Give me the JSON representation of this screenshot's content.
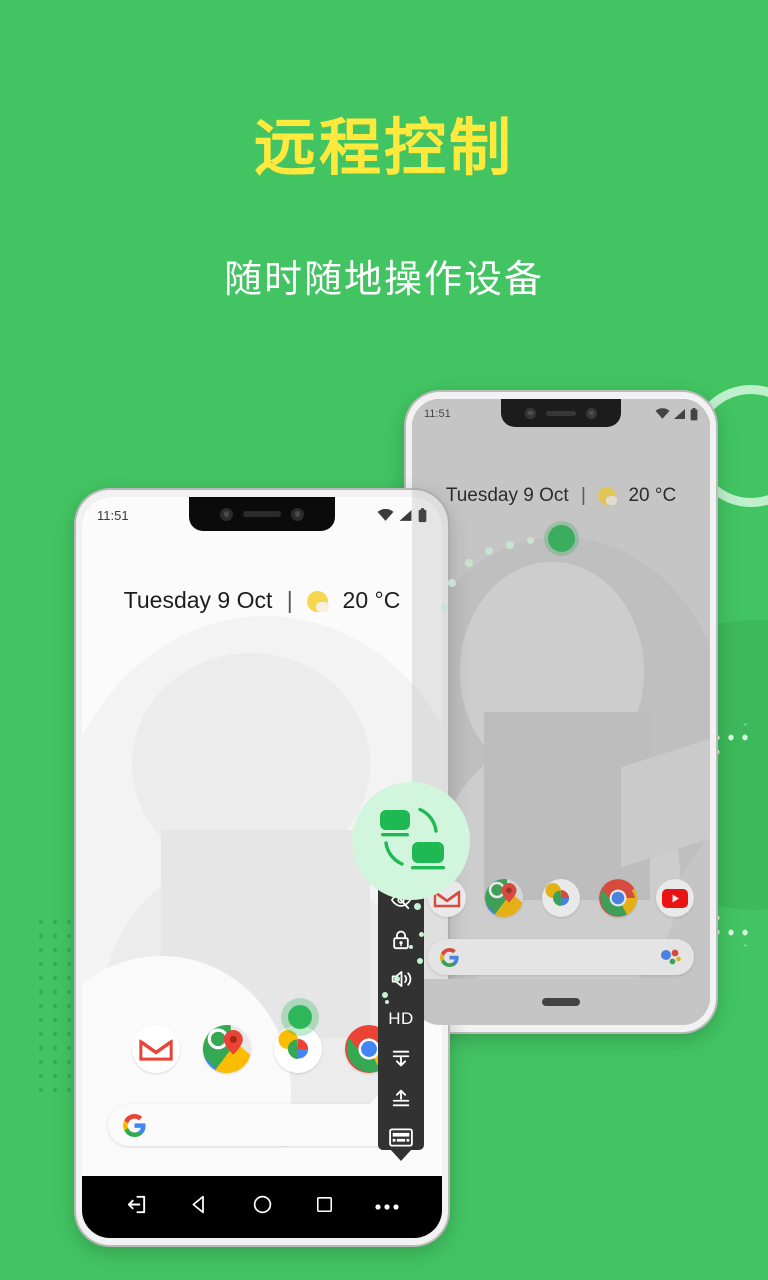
{
  "theme": {
    "background": "#42c462",
    "title_color": "#ffe93d",
    "subtitle_color": "#ffffff",
    "accent_green": "#2ebd5c",
    "badge_bg": "#d2f6dd",
    "toolbar_bg": "#323232"
  },
  "header": {
    "title": "远程控制",
    "subtitle": "随时随地操作设备"
  },
  "phone_front": {
    "status_bar": {
      "time": "11:51",
      "icons": [
        "wifi-icon",
        "signal-icon",
        "battery-icon"
      ]
    },
    "weather": {
      "date": "Tuesday 9 Oct",
      "separator": "|",
      "icon": "sun-cloud-icon",
      "temperature": "20 °C"
    },
    "dock": [
      {
        "name": "gmail-icon",
        "label": "Gmail"
      },
      {
        "name": "maps-icon",
        "label": "Maps"
      },
      {
        "name": "photos-icon",
        "label": "Photos"
      },
      {
        "name": "chrome-icon",
        "label": "Chrome"
      }
    ],
    "search_bar": {
      "logo": "google-g-icon",
      "placeholder": ""
    },
    "nav_bar": [
      {
        "name": "exit-session-icon",
        "label": "Exit"
      },
      {
        "name": "back-icon",
        "label": "Back"
      },
      {
        "name": "home-icon",
        "label": "Home"
      },
      {
        "name": "recents-icon",
        "label": "Recents"
      },
      {
        "name": "more-icon",
        "label": "More"
      }
    ]
  },
  "phone_back": {
    "status_bar": {
      "time": "11:51",
      "icons": [
        "wifi-icon",
        "signal-icon",
        "battery-icon"
      ]
    },
    "weather": {
      "date": "Tuesday 9 Oct",
      "separator": "|",
      "icon": "sun-cloud-icon",
      "temperature": "20 °C"
    },
    "dock": [
      {
        "name": "gmail-icon",
        "label": "Gmail"
      },
      {
        "name": "maps-icon",
        "label": "Maps"
      },
      {
        "name": "photos-icon",
        "label": "Photos"
      },
      {
        "name": "chrome-icon",
        "label": "Chrome"
      },
      {
        "name": "youtube-icon",
        "label": "YouTube"
      }
    ],
    "search_bar": {
      "logo": "google-g-icon",
      "assistant": "google-assistant-icon"
    }
  },
  "remote_toolbar": {
    "items": [
      {
        "name": "visibility-off-icon",
        "label": "Hide screen",
        "glyph": ""
      },
      {
        "name": "lock-icon",
        "label": "Lock",
        "glyph": ""
      },
      {
        "name": "volume-icon",
        "label": "Volume",
        "glyph": ""
      },
      {
        "name": "hd-quality-icon",
        "label": "HD",
        "glyph": "HD"
      },
      {
        "name": "download-icon",
        "label": "Download",
        "glyph": ""
      },
      {
        "name": "upload-icon",
        "label": "Upload",
        "glyph": ""
      },
      {
        "name": "keyboard-icon",
        "label": "Keyboard",
        "glyph": ""
      }
    ],
    "collapse": {
      "name": "collapse-toolbar-caret",
      "label": "Collapse"
    }
  },
  "brand_badge": {
    "name": "remote-control-badge",
    "label": "Remote control"
  },
  "decorations": {
    "ring_top_right": "ring-decoration",
    "dot_grid_left": "dot-grid-decoration",
    "dot_arc_right": "dot-arc-decoration",
    "blob_right": "blob-decoration"
  }
}
